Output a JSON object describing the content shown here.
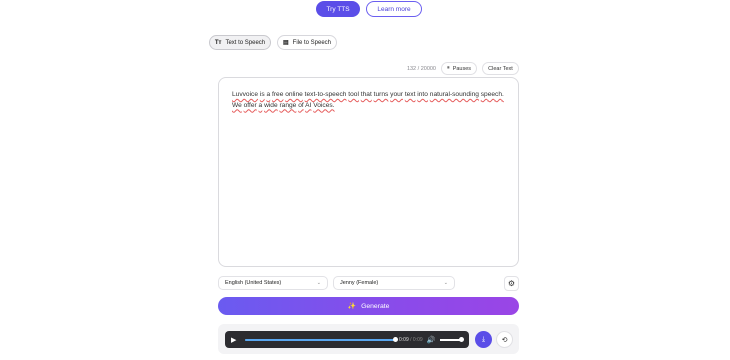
{
  "header": {
    "try_label": "Try TTS",
    "learn_label": "Learn more"
  },
  "tabs": [
    {
      "label": "Text to Speech",
      "icon": "text-size-icon",
      "glyph": "Tт",
      "active": true
    },
    {
      "label": "File to Speech",
      "icon": "file-icon",
      "glyph": "▤",
      "active": false
    }
  ],
  "editor_toolbar": {
    "counter": "132 / 20000",
    "pauses_label": "Pauses",
    "clear_label": "Clear Text"
  },
  "editor": {
    "text_words_line1": [
      "Luvvoice",
      "is",
      "a",
      "free",
      "online",
      "text-to-speech",
      "tool",
      "that",
      "turns",
      "your",
      "text",
      "into",
      "natural-sounding",
      "speech."
    ],
    "text_words_line2": [
      "We",
      "offer",
      "a",
      "wide",
      "range",
      "of",
      "AI",
      "Voices."
    ]
  },
  "controls": {
    "language": "English (United States)",
    "voice": "Jenny (Female)",
    "generate_label": "Generate"
  },
  "player": {
    "current_time": "0:09",
    "total_time": "/ 0:09",
    "progress": 1.0,
    "volume": 1.0
  },
  "colors": {
    "accent": "#5b4ee8",
    "gradient_end": "#9a45e6",
    "spell_underline": "#e55a5a"
  }
}
